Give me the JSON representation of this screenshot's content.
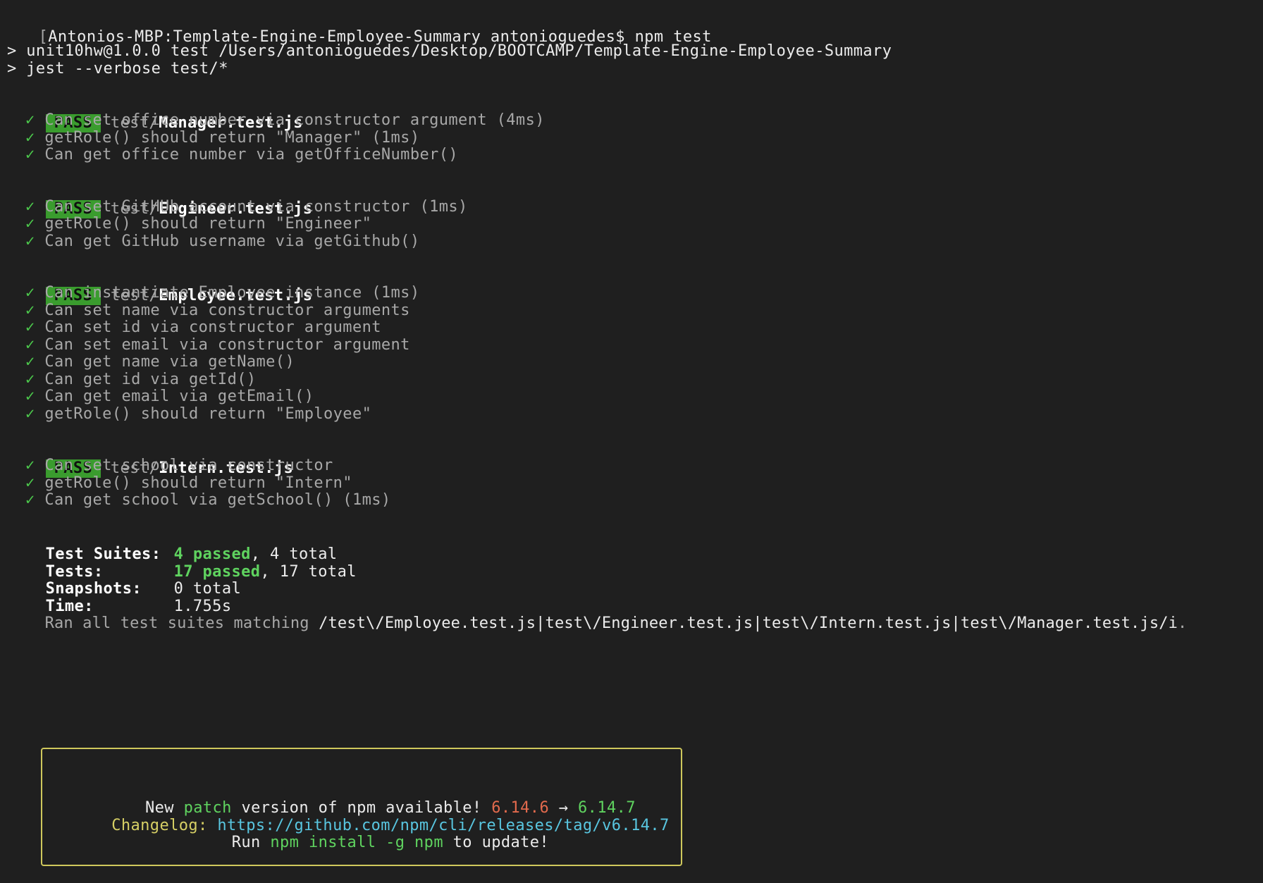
{
  "prompt": {
    "open_bracket": "[",
    "host_path": "Antonios-MBP:Template-Engine-Employee-Summary antonioguedes$",
    "command": "npm test"
  },
  "script": {
    "line1": "> unit10hw@1.0.0 test /Users/antonioguedes/Desktop/BOOTCAMP/Template-Engine-Employee-Summary",
    "line2": "> jest --verbose test/*"
  },
  "suites": [
    {
      "status": "PASS",
      "dir": "test/",
      "file": "Manager.test.js",
      "tests": [
        "Can set office number via constructor argument (4ms)",
        "getRole() should return \"Manager\" (1ms)",
        "Can get office number via getOfficeNumber()"
      ]
    },
    {
      "status": "PASS",
      "dir": "test/",
      "file": "Engineer.test.js",
      "tests": [
        "Can set GitHUb account via constructor (1ms)",
        "getRole() should return \"Engineer\"",
        "Can get GitHub username via getGithub()"
      ]
    },
    {
      "status": "PASS",
      "dir": "test/",
      "file": "Employee.test.js",
      "tests": [
        "Can instantiate Employee instance (1ms)",
        "Can set name via constructor arguments",
        "Can set id via constructor argument",
        "Can set email via constructor argument",
        "Can get name via getName()",
        "Can get id via getId()",
        "Can get email via getEmail()",
        "getRole() should return \"Employee\""
      ]
    },
    {
      "status": "PASS",
      "dir": "test/",
      "file": "Intern.test.js",
      "tests": [
        "Can set school via constructor",
        "getRole() should return \"Intern\"",
        "Can get school via getSchool() (1ms)"
      ]
    }
  ],
  "check_glyph": "✓",
  "summary": {
    "suites_label": "Test Suites:",
    "suites_passed": "4 passed",
    "suites_total": ", 4 total",
    "tests_label": "Tests:",
    "tests_passed": "17 passed",
    "tests_total": ", 17 total",
    "snapshots_label": "Snapshots:",
    "snapshots_value": "0 total",
    "time_label": "Time:",
    "time_value": "1.755s",
    "ran_prefix": "Ran all test suites matching ",
    "ran_pattern": "/test\\/Employee.test.js|test\\/Engineer.test.js|test\\/Intern.test.js|test\\/Manager.test.js/i",
    "ran_suffix": "."
  },
  "npm_notice": {
    "new_text": "New ",
    "patch": "patch",
    "version_text": " version of npm available! ",
    "old_version": "6.14.6",
    "arrow": " → ",
    "new_version": "6.14.7",
    "changelog_label": "Changelog:",
    "changelog_url": "https://github.com/npm/cli/releases/tag/v6.14.7",
    "run_text": "Run ",
    "install_cmd": "npm install -g npm",
    "update_text": " to update!"
  },
  "colors": {
    "background": "#1f1f1f",
    "pass_bg": "#3a9c2e",
    "check": "#4cc94c",
    "passed": "#5fd35f",
    "old_version": "#e36a4d",
    "changelog": "#d6cf65",
    "url": "#59c6e0",
    "box_border": "#cfc85c"
  }
}
